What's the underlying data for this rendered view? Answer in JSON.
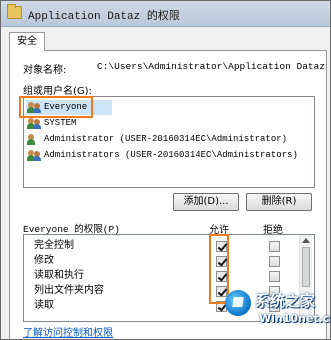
{
  "window": {
    "title": "Application Dataz 的权限"
  },
  "tabs": [
    {
      "label": "安全"
    }
  ],
  "object": {
    "label": "对象名称:",
    "value": "C:\\Users\\Administrator\\Application Dataz"
  },
  "groups": {
    "label": "组或用户名(G):",
    "items": [
      {
        "name": "Everyone"
      },
      {
        "name": "SYSTEM"
      },
      {
        "name": "Administrator (USER-20160314EC\\Administrator)"
      },
      {
        "name": "Administrators (USER-20160314EC\\Administrators)"
      }
    ],
    "selected_index": 0
  },
  "buttons": {
    "add": "添加(D)...",
    "remove": "删除(R)"
  },
  "permissions": {
    "title": "Everyone 的权限(P)",
    "allow_header": "允许",
    "deny_header": "拒绝",
    "rows": [
      {
        "name": "完全控制",
        "allow": true,
        "deny": false
      },
      {
        "name": "修改",
        "allow": true,
        "deny": false
      },
      {
        "name": "读取和执行",
        "allow": true,
        "deny": false
      },
      {
        "name": "列出文件夹内容",
        "allow": true,
        "deny": false
      },
      {
        "name": "读取",
        "allow": true,
        "deny": false
      }
    ]
  },
  "link": {
    "label": "了解访问控制和权限"
  },
  "watermark": {
    "cn": "系统之家",
    "en": "Win10net.com"
  },
  "colors": {
    "highlight": "#f07a1e",
    "selection": "#cde4f7",
    "link": "#0a5bc4"
  },
  "icons": {
    "title": "folder-icon",
    "user": "user-group-icon"
  }
}
